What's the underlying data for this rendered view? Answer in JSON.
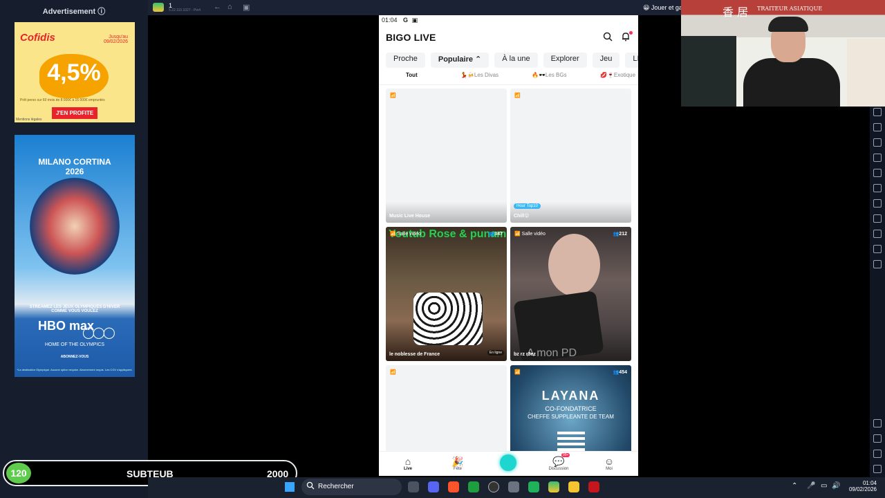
{
  "ads": {
    "header": "Advertisement",
    "ad1": {
      "brand": "Cofidis",
      "date_line1": "Jusqu'au",
      "date_line2": "09/02/2026",
      "rate": "4,5%",
      "fine_print": "Prêt perso sur 60 mois de 8 000€ à 15 000€ empruntés",
      "cta": "J'EN PROFITE",
      "legal": "Mentions légales"
    },
    "ad2": {
      "title_line1": "MILANO CORTINA",
      "title_line2": "2026",
      "tagline": "STREAMEZ LES JEUX OLYMPIQUES D'HIVER COMME VOUS VOULEZ",
      "hbo": "HBO max",
      "home": "HOME OF THE OLYMPICS",
      "cta": "ABONNEZ-VOUS",
      "fine": "*La destination Olympique. Aucune option requise. Abonnement requis. Les CGV s'appliquent."
    }
  },
  "topbar": {
    "tab_number": "1",
    "tab_ip": "5.22.110.1027 - Pin4",
    "right_text": "Jouer et gagn"
  },
  "phone": {
    "status_time": "01:04",
    "logo": "BIGO LIVE",
    "tabs": [
      "Proche",
      "Populaire ⌃",
      "À la une",
      "Explorer",
      "Jeu",
      "LIVE Virtue"
    ],
    "subtabs": [
      "Tout",
      "💃🍻Les Divas",
      "🔥🕶️Les BGs",
      "💋🍷Exotique"
    ],
    "cards": [
      {
        "signal": "📶",
        "viewers": "",
        "name": "Music Live House",
        "tag": ""
      },
      {
        "signal": "📶",
        "viewers": "",
        "name": "Chill😮",
        "tag": "Hour Top10"
      },
      {
        "signal": "📶 Salle vidéo",
        "viewers": "👥347",
        "name": "le noblesse de France",
        "overlay": "Youtub Rose & punam",
        "status": "En ligne"
      },
      {
        "signal": "📶 Salle vidéo",
        "viewers": "👥212",
        "name": "bz  rz r3ez",
        "watermark": "A mon PD"
      },
      {
        "signal": "📶",
        "viewers": "",
        "name": ""
      },
      {
        "signal": "📶",
        "viewers": "👥454",
        "title": "LAYANA",
        "line2": "CO-FONDATRICE",
        "line3": "CHEFFE SUPPLEANTE DE TEAM"
      }
    ],
    "nav": {
      "live": "Live",
      "fete": "Fête",
      "discussion": "Discussion",
      "discussion_badge": "99+",
      "moi": "Moi"
    }
  },
  "widget": {
    "count": "120",
    "label": "SUBTEUB",
    "goal": "2000"
  },
  "taskbar": {
    "search": "Rechercher",
    "time": "01:04",
    "date": "09/02/2026"
  }
}
